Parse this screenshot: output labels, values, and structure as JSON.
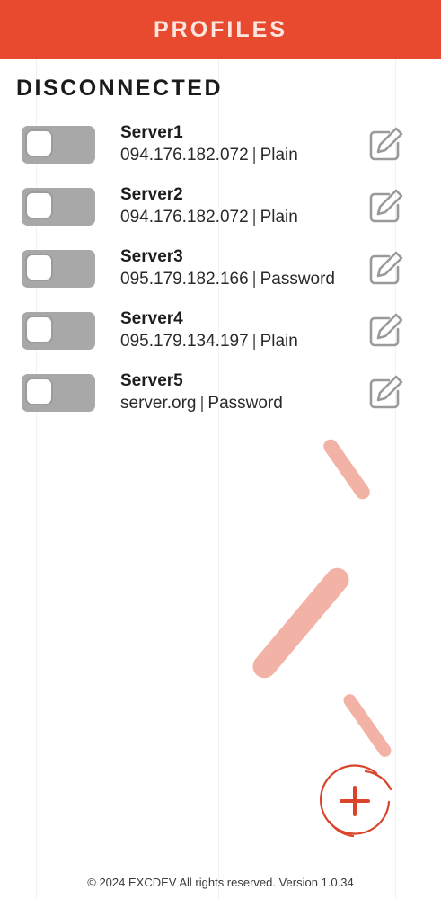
{
  "header": {
    "title": "PROFILES"
  },
  "status_heading": "DISCONNECTED",
  "servers": [
    {
      "name": "Server1",
      "host": "094.176.182.072",
      "auth": "Plain",
      "connected": false
    },
    {
      "name": "Server2",
      "host": "094.176.182.072",
      "auth": "Plain",
      "connected": false
    },
    {
      "name": "Server3",
      "host": "095.179.182.166",
      "auth": "Password",
      "connected": false
    },
    {
      "name": "Server4",
      "host": "095.179.134.197",
      "auth": "Plain",
      "connected": false
    },
    {
      "name": "Server5",
      "host": "server.org",
      "auth": "Password",
      "connected": false
    }
  ],
  "separator": "|",
  "icons": {
    "edit": "edit-icon",
    "add": "plus-icon"
  },
  "colors": {
    "accent": "#e84a2f",
    "toggle_off": "#a8a8a8",
    "decor": "#f2b3a6",
    "fab_ring": "#d9442b"
  },
  "footer": {
    "text": "© 2024 EXCDEV All rights reserved. Version 1.0.34"
  }
}
